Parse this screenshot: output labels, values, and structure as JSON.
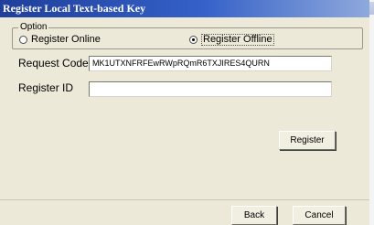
{
  "window": {
    "title": "Register Local Text-based Key"
  },
  "option_group": {
    "legend": "Option",
    "radio_online": {
      "label": "Register Online",
      "checked": false
    },
    "radio_offline": {
      "label": "Register Offline",
      "checked": true
    }
  },
  "request_code": {
    "label": "Request Code",
    "value": "MK1UTXNFRFEwRWpRQmR6TXJIRES4QURN"
  },
  "register_id": {
    "label": "Register ID",
    "value": ""
  },
  "buttons": {
    "register": "Register",
    "back": "Back",
    "cancel": "Cancel"
  }
}
